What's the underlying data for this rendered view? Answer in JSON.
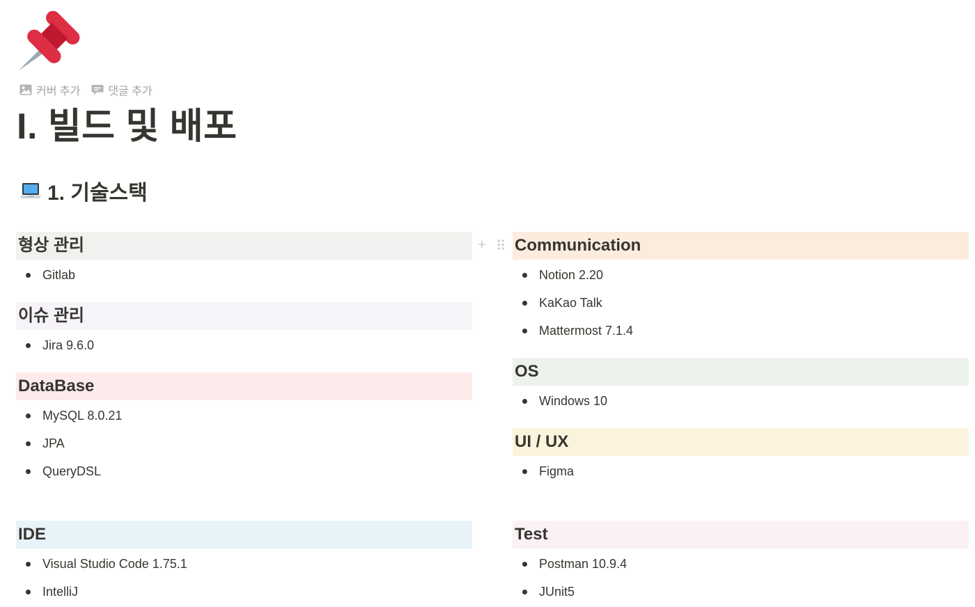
{
  "page": {
    "icon": "pushpin-icon",
    "actions": [
      {
        "icon": "image-icon",
        "label": "커버 추가"
      },
      {
        "icon": "comment-icon",
        "label": "댓글 추가"
      }
    ],
    "title": "I. 빌드 및 배포"
  },
  "section": {
    "icon": "laptop-icon",
    "title": "1. 기술스택"
  },
  "blocks": {
    "vcs": {
      "title": "형상 관리",
      "color": "#f1f1ef",
      "items": [
        "Gitlab"
      ]
    },
    "issue": {
      "title": "이슈 관리",
      "color": "#f6f3f9",
      "items": [
        "Jira 9.6.0"
      ]
    },
    "database": {
      "title": "DataBase",
      "color": "#fdebec",
      "items": [
        "MySQL 8.0.21",
        "JPA",
        "QueryDSL"
      ]
    },
    "ide": {
      "title": "IDE",
      "color": "#e7f3f8",
      "items": [
        "Visual Studio Code 1.75.1",
        "IntelliJ"
      ]
    },
    "communication": {
      "title": "Communication",
      "color": "#fbecdd",
      "items": [
        "Notion 2.20",
        "KaKao Talk",
        "Mattermost 7.1.4"
      ]
    },
    "os": {
      "title": "OS",
      "color": "#edf3ec",
      "items": [
        "Windows 10"
      ]
    },
    "uiux": {
      "title": "UI / UX",
      "color": "#fbf3db",
      "items": [
        "Figma"
      ]
    },
    "test": {
      "title": "Test",
      "color": "#faf1f5",
      "items": [
        "Postman 10.9.4",
        "JUnit5"
      ]
    }
  },
  "handles": {
    "add": "+",
    "drag": "⠿"
  }
}
